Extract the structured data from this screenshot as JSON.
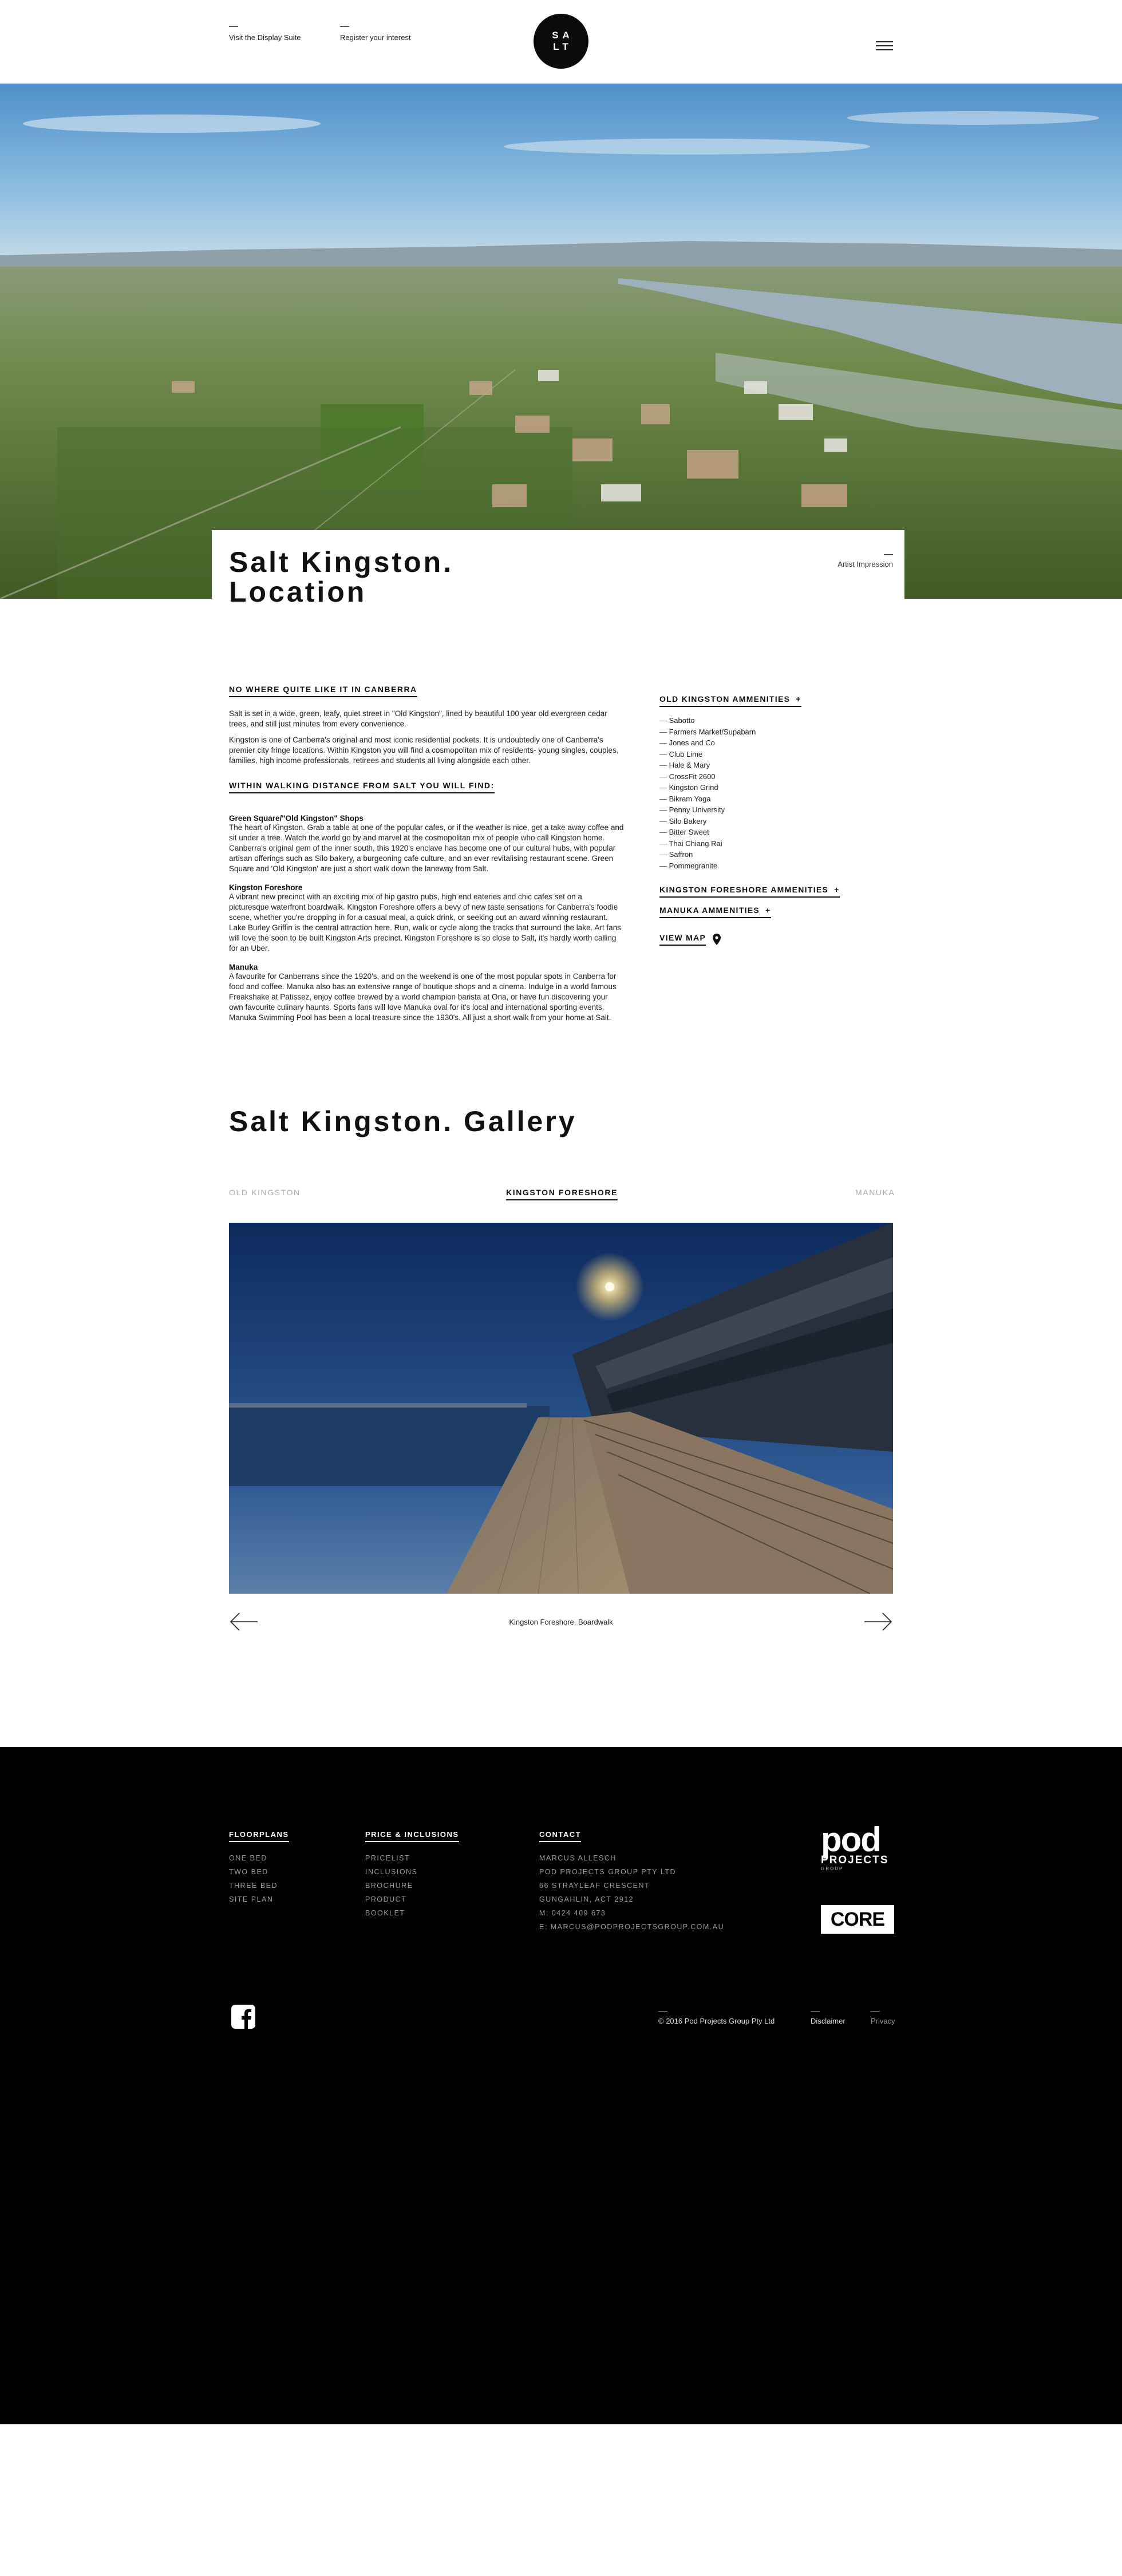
{
  "header": {
    "link_display_suite": "Visit the Display Suite",
    "link_register": "Register your  interest",
    "logo_line1": "SA",
    "logo_line2": "LT"
  },
  "hero": {
    "title": "Salt Kingston. Location",
    "note": "Artist Impression"
  },
  "location": {
    "heading": "NO WHERE QUITE LIKE IT IN CANBERRA",
    "intro_1": "Salt is set in a wide, green, leafy, quiet street in \"Old Kingston\", lined by beautiful 100 year old evergreen cedar trees, and still just minutes from every convenience.",
    "intro_2": "Kingston is one of Canberra's original and most iconic residential pockets. It is undoubtedly one of Canberra's premier city fringe locations. Within Kingston you will find a cosmopolitan mix of residents- young singles, couples, families, high income professionals, retirees and students all living alongside each other.",
    "walk_heading": "WITHIN WALKING DISTANCE FROM SALT YOU WILL FIND:",
    "items": [
      {
        "title": "Green Square/\"Old Kingston\" Shops",
        "text": "The heart of Kingston. Grab a table at one of the popular cafes, or if the weather is nice, get a take away coffee and sit under a tree. Watch the world go by and marvel at the cosmopolitan mix of people who call Kingston home. Canberra's original gem of the inner south, this 1920's enclave has become one of our cultural hubs, with popular artisan offerings such as Silo bakery, a burgeoning cafe culture, and an ever revitalising restaurant scene. Green Square and 'Old Kingston' are just a short walk down the laneway from Salt."
      },
      {
        "title": "Kingston Foreshore",
        "text": "A vibrant new precinct with an exciting mix of hip gastro pubs, high end eateries and chic cafes set on a picturesque waterfront boardwalk. Kingston Foreshore offers a bevy of new taste sensations for Canberra's foodie scene, whether you're dropping in for a casual meal, a quick drink, or seeking out an award winning restaurant. Lake Burley Griffin is the central attraction here. Run, walk or cycle along the tracks that surround the lake. Art fans will love the soon to be built Kingston Arts precinct. Kingston Foreshore is so close to Salt, it's hardly worth calling for an Uber."
      },
      {
        "title": "Manuka",
        "text": "A favourite for Canberrans since the 1920's, and on the weekend is one of the most popular spots in Canberra for food and coffee. Manuka also has an extensive range of boutique shops and a cinema. Indulge in a world famous Freakshake at Patissez, enjoy coffee brewed by a world champion barista at Ona, or have fun discovering your own favourite culinary haunts. Sports fans will love Manuka oval for it's local and international sporting events. Manuka Swimming Pool has been a local treasure since the 1930's. All just a short walk from your home at Salt."
      }
    ]
  },
  "amenities": {
    "old_kingston_heading": "OLD KINGSTON AMMENITIES",
    "plus": "+",
    "old_kingston_items": [
      "Sabotto",
      "Farmers Market/Supabarn",
      "Jones and Co",
      "Club Lime",
      "Hale & Mary",
      "CrossFit 2600",
      "Kingston Grind",
      "Bikram Yoga",
      "Penny University",
      "Silo Bakery",
      "Bitter Sweet",
      "Thai Chiang Rai",
      "Saffron",
      "Pommegranite"
    ],
    "foreshore_heading": "KINGSTON FORESHORE AMMENITIES",
    "manuka_heading": "MANUKA AMMENITIES",
    "view_map": "VIEW MAP"
  },
  "gallery": {
    "title": "Salt Kingston. Gallery",
    "tabs": [
      "OLD KINGSTON",
      "KINGSTON FORESHORE",
      "MANUKA"
    ],
    "active_tab": "KINGSTON FORESHORE",
    "caption": "Kingston Foreshore. Boardwalk"
  },
  "footer": {
    "floorplans_heading": "FLOORPLANS",
    "floorplans": [
      "ONE BED",
      "TWO BED",
      "THREE BED",
      "SITE PLAN"
    ],
    "price_heading": "PRICE & INCLUSIONS",
    "price_items": [
      "PRICELIST",
      "INCLUSIONS",
      "BROCHURE",
      "PRODUCT",
      "BOOKLET"
    ],
    "contact_heading": "CONTACT",
    "contact": [
      "MARCUS ALLESCH",
      "POD PROJECTS GROUP PTY LTD",
      "66 STRAYLEAF CRESCENT",
      "GUNGAHLIN, ACT 2912",
      "M: 0424 409 673",
      "E: MARCUS@PODPROJECTSGROUP.COM.AU"
    ],
    "pod_logo_main": "pod",
    "pod_logo_sub": "PROJECTS",
    "pod_logo_small": "GROUP",
    "core_logo": "CORE",
    "copyright": "© 2016 Pod Projects Group Pty Ltd",
    "disclaimer": "Disclaimer",
    "privacy": "Privacy"
  }
}
